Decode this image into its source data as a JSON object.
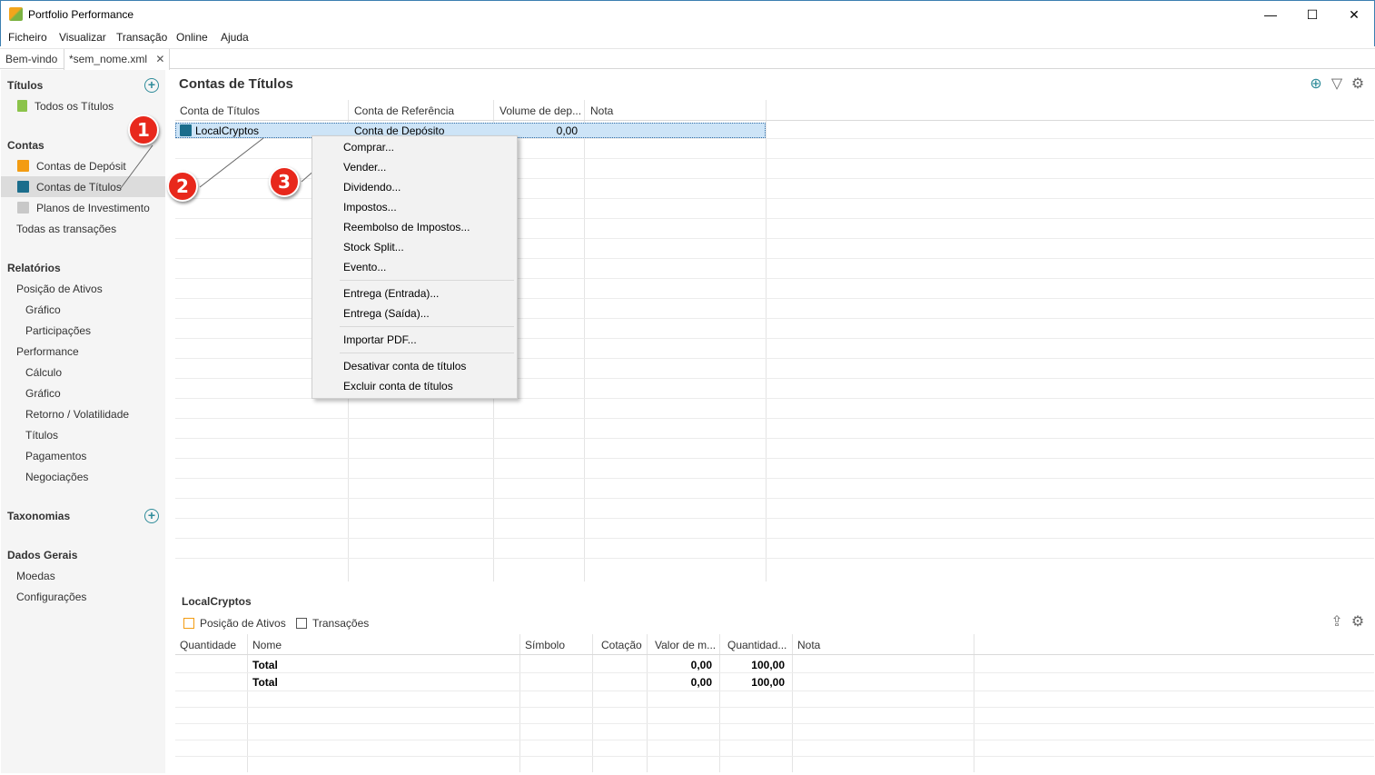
{
  "window": {
    "title": "Portfolio Performance",
    "minimize": "—",
    "maximize": "☐",
    "close": "✕"
  },
  "menu": [
    "Ficheiro",
    "Visualizar",
    "Transação",
    "Online",
    "Ajuda"
  ],
  "tabs": [
    {
      "label": "Bem-vindo"
    },
    {
      "label": "*sem_nome.xml",
      "close": "✕"
    }
  ],
  "sidebar": {
    "titulos": {
      "heading": "Títulos",
      "items": [
        "Todos os Títulos"
      ]
    },
    "contas": {
      "heading": "Contas",
      "items": [
        "Contas de Depósit",
        "Contas de Títulos",
        "Planos de Investimento",
        "Todas as transações"
      ]
    },
    "relatorios": {
      "heading": "Relatórios",
      "items": [
        "Posição de Ativos",
        "Gráfico",
        "Participações",
        "Performance",
        "Cálculo",
        "Gráfico",
        "Retorno / Volatilidade",
        "Títulos",
        "Pagamentos",
        "Negociações"
      ]
    },
    "taxonomias": {
      "heading": "Taxonomias"
    },
    "dados_gerais": {
      "heading": "Dados Gerais",
      "items": [
        "Moedas",
        "Configurações"
      ]
    }
  },
  "main": {
    "title": "Contas de Títulos",
    "columns": [
      "Conta de Títulos",
      "Conta de Referência",
      "Volume de dep...",
      "Nota"
    ],
    "rows": [
      {
        "account": "LocalCryptos",
        "reference": "Conta de Depósito",
        "volume": "0,00",
        "note": ""
      }
    ]
  },
  "context_menu": {
    "groups": [
      [
        "Comprar...",
        "Vender...",
        "Dividendo...",
        "Impostos...",
        "Reembolso de Impostos...",
        "Stock Split...",
        "Evento..."
      ],
      [
        "Entrega (Entrada)...",
        "Entrega (Saída)..."
      ],
      [
        "Importar PDF..."
      ],
      [
        "Desativar conta de títulos",
        "Excluir conta de títulos"
      ]
    ]
  },
  "callouts": [
    "1",
    "2",
    "3"
  ],
  "bottom": {
    "title": "LocalCryptos",
    "tabs": [
      "Posição de Ativos",
      "Transações"
    ],
    "columns": [
      "Quantidade",
      "Nome",
      "Símbolo",
      "Cotação",
      "Valor de m...",
      "Quantidad...",
      "Nota"
    ],
    "rows": [
      {
        "name": "Total",
        "valor": "0,00",
        "quantidade": "100,00"
      },
      {
        "name": "Total",
        "valor": "0,00",
        "quantidade": "100,00"
      }
    ]
  },
  "colors": {
    "accent": "#2f8c9a",
    "deposit_icon": "#f39c12",
    "securities_icon": "#1b6d8c",
    "plans_icon": "#c8c8c8",
    "titles_icon": "#8bc34a",
    "callout": "#e8281c",
    "selection": "#cde4f7"
  }
}
